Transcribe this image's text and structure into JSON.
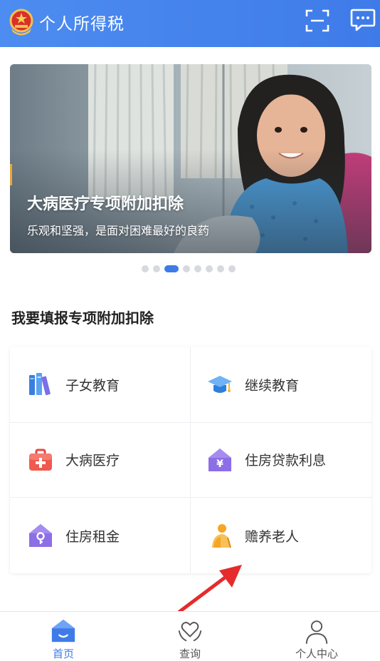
{
  "header": {
    "title": "个人所得税",
    "emblem_icon": "national-emblem-icon",
    "scan_icon": "scan-icon",
    "message_icon": "message-icon"
  },
  "banner": {
    "title": "大病医疗专项附加扣除",
    "subtitle": "乐观和坚强，是面对困难最好的良药",
    "page_count": 8,
    "active_page": 3
  },
  "section": {
    "title": "我要填报专项附加扣除"
  },
  "deductions": [
    {
      "label": "子女教育",
      "icon": "books-icon",
      "color": "#4a90e8"
    },
    {
      "label": "继续教育",
      "icon": "graduation-cap-icon",
      "color": "#3c8ce6"
    },
    {
      "label": "大病医疗",
      "icon": "medical-kit-icon",
      "color": "#f1594f"
    },
    {
      "label": "住房贷款利息",
      "icon": "house-yen-icon",
      "color": "#8c6ee6"
    },
    {
      "label": "住房租金",
      "icon": "house-key-icon",
      "color": "#8c6ee6"
    },
    {
      "label": "赡养老人",
      "icon": "elder-icon",
      "color": "#f5a623"
    }
  ],
  "bottom_nav": [
    {
      "label": "首页",
      "icon": "home-icon",
      "active": true
    },
    {
      "label": "查询",
      "icon": "heart-hands-icon",
      "active": false
    },
    {
      "label": "个人中心",
      "icon": "user-icon",
      "active": false
    }
  ],
  "colors": {
    "primary": "#3e7be9",
    "annotation_arrow": "#e52b2b"
  }
}
